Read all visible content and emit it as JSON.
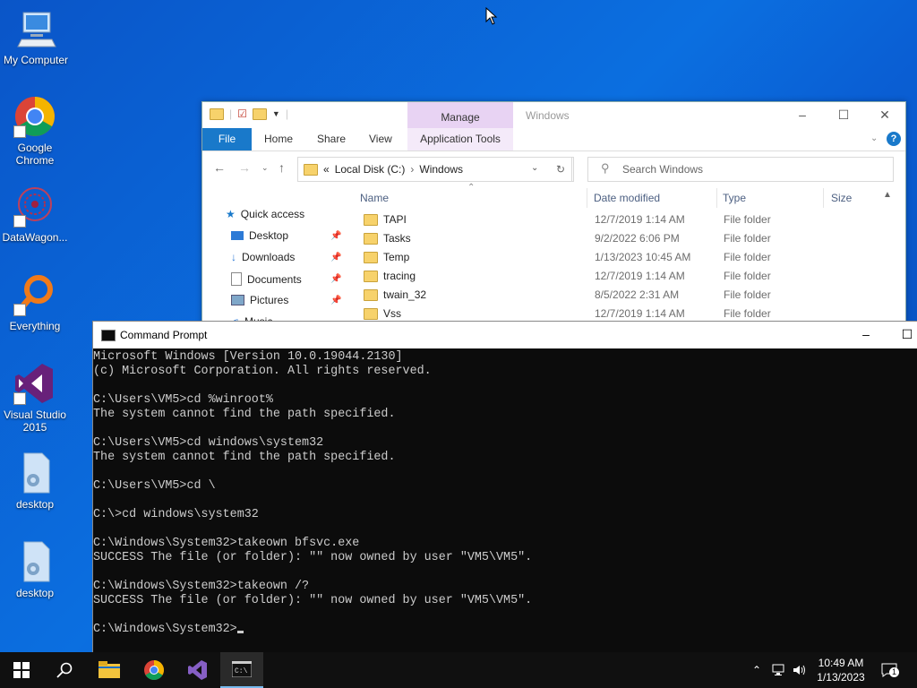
{
  "desktop": {
    "icons": [
      {
        "label": "My Computer",
        "icon": "computer-icon"
      },
      {
        "label": "Google Chrome",
        "icon": "chrome-icon"
      },
      {
        "label": "DataWagon...",
        "icon": "datawagon-icon"
      },
      {
        "label": "Everything",
        "icon": "everything-icon"
      },
      {
        "label": "Visual Studio 2015",
        "icon": "visual-studio-icon"
      },
      {
        "label": "desktop",
        "icon": "file-icon"
      },
      {
        "label": "desktop",
        "icon": "file-icon"
      }
    ]
  },
  "explorer": {
    "title": "Windows",
    "manage_tab": "Manage",
    "ribbon_tabs": [
      "File",
      "Home",
      "Share",
      "View",
      "Application Tools"
    ],
    "address": {
      "prefix": "«",
      "parts": [
        "Local Disk (C:)",
        "Windows"
      ],
      "sep": "›"
    },
    "search_placeholder": "Search Windows",
    "nav": {
      "quick_access": "Quick access",
      "items": [
        "Desktop",
        "Downloads",
        "Documents",
        "Pictures",
        "Music"
      ]
    },
    "columns": [
      "Name",
      "Date modified",
      "Type",
      "Size"
    ],
    "rows": [
      {
        "name": "TAPI",
        "date": "12/7/2019 1:14 AM",
        "type": "File folder"
      },
      {
        "name": "Tasks",
        "date": "9/2/2022 6:06 PM",
        "type": "File folder"
      },
      {
        "name": "Temp",
        "date": "1/13/2023 10:45 AM",
        "type": "File folder"
      },
      {
        "name": "tracing",
        "date": "12/7/2019 1:14 AM",
        "type": "File folder"
      },
      {
        "name": "twain_32",
        "date": "8/5/2022 2:31 AM",
        "type": "File folder"
      },
      {
        "name": "Vss",
        "date": "12/7/2019 1:14 AM",
        "type": "File folder"
      }
    ]
  },
  "cmd": {
    "title": "Command Prompt",
    "lines": [
      "Microsoft Windows [Version 10.0.19044.2130]",
      "(c) Microsoft Corporation. All rights reserved.",
      "",
      "C:\\Users\\VM5>cd %winroot%",
      "The system cannot find the path specified.",
      "",
      "C:\\Users\\VM5>cd windows\\system32",
      "The system cannot find the path specified.",
      "",
      "C:\\Users\\VM5>cd \\",
      "",
      "C:\\>cd windows\\system32",
      "",
      "C:\\Windows\\System32>takeown bfsvc.exe",
      "SUCCESS The file (or folder): \"\" now owned by user \"VM5\\VM5\".",
      "",
      "C:\\Windows\\System32>takeown /?",
      "SUCCESS The file (or folder): \"\" now owned by user \"VM5\\VM5\".",
      ""
    ],
    "prompt": "C:\\Windows\\System32>"
  },
  "taskbar": {
    "time": "10:49 AM",
    "date": "1/13/2023",
    "notification_count": "1"
  }
}
